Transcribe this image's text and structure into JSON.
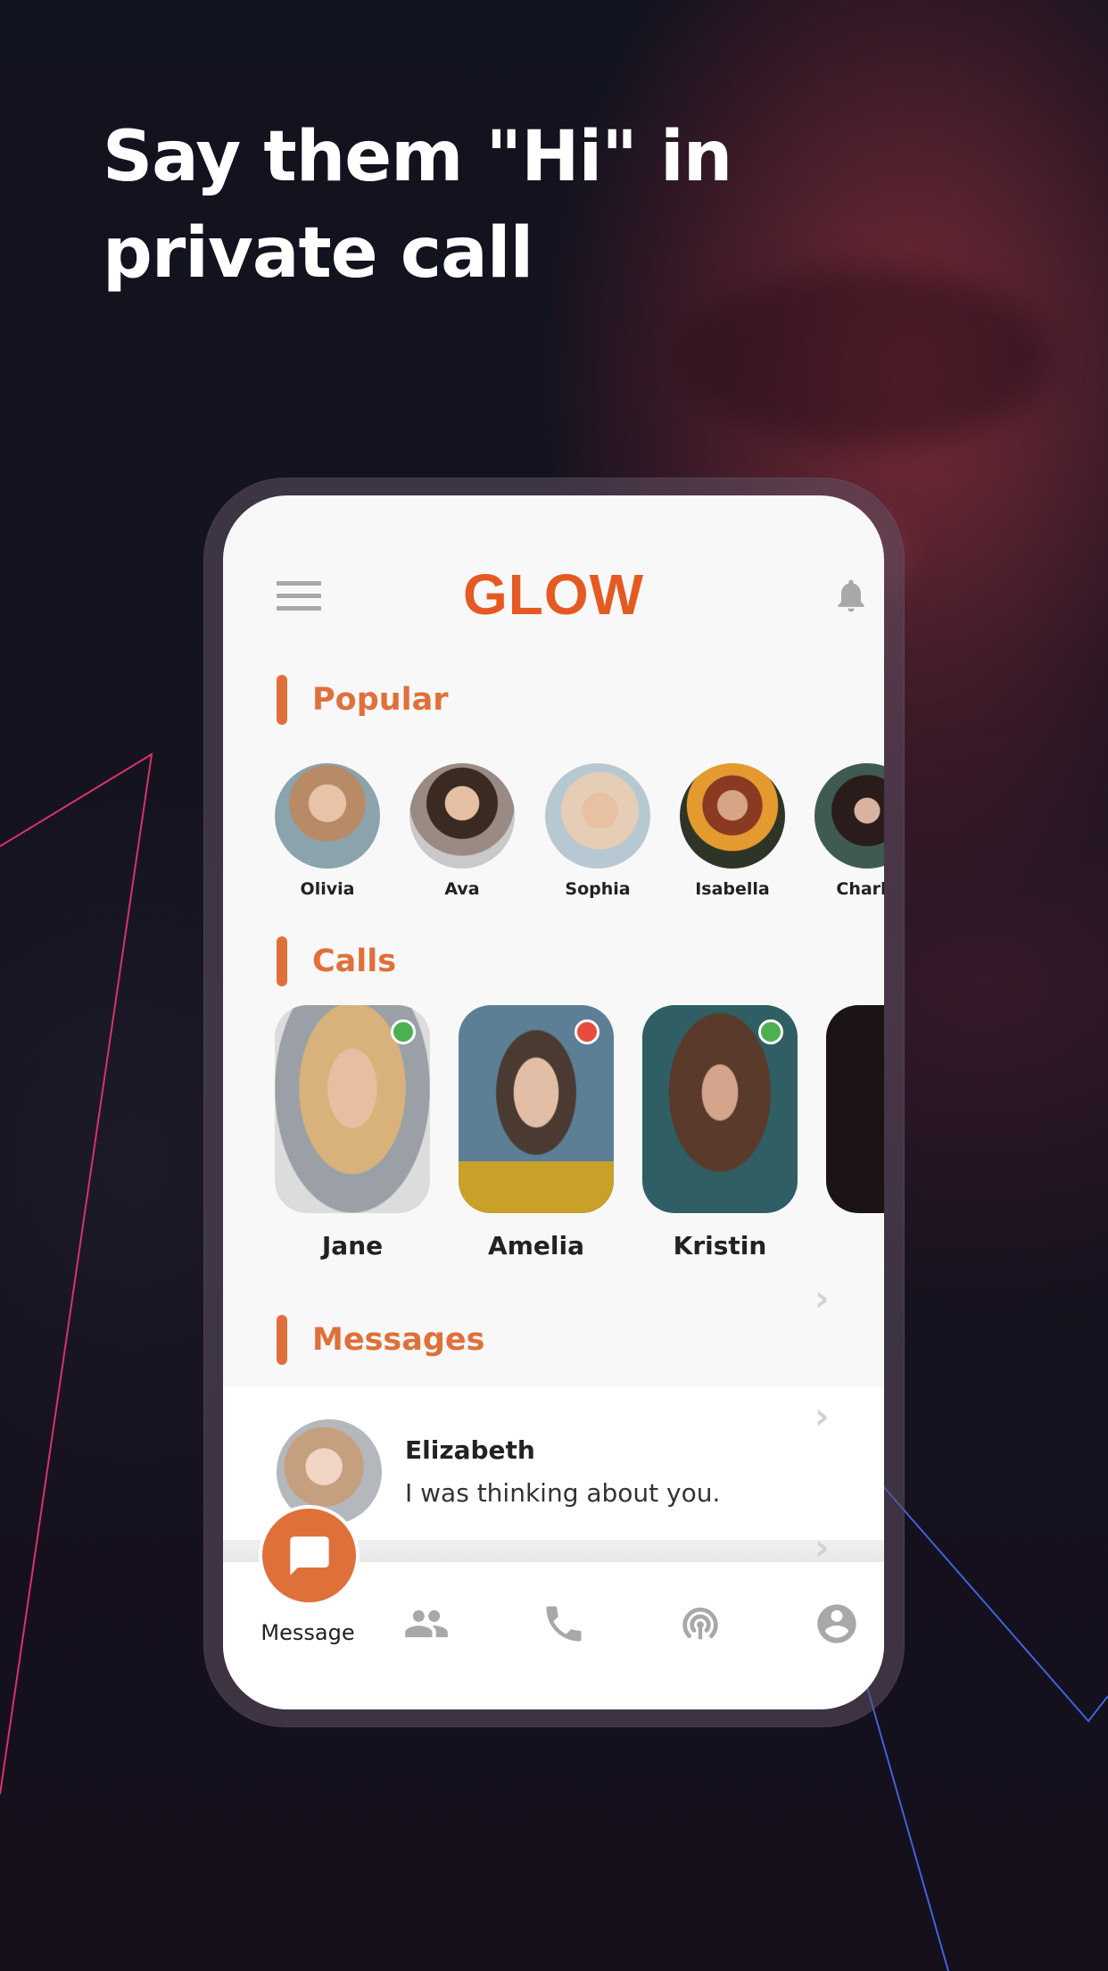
{
  "headline": {
    "line1": "Say them \"Hi\" in",
    "line2": "private call"
  },
  "colors": {
    "accent": "#e0703a",
    "logo": "#e55a22",
    "online": "#4caf50",
    "busy": "#e74c3c",
    "icon_gray": "#a8a8a8"
  },
  "app": {
    "logo": "GLOW",
    "header_icons": {
      "left": "menu-icon",
      "right": "bell-icon"
    },
    "sections": {
      "popular": "Popular",
      "calls": "Calls",
      "messages": "Messages"
    },
    "popular": [
      {
        "name": "Olivia"
      },
      {
        "name": "Ava"
      },
      {
        "name": "Sophia"
      },
      {
        "name": "Isabella"
      },
      {
        "name": "Charlo"
      }
    ],
    "calls": [
      {
        "name": "Jane",
        "status": "online"
      },
      {
        "name": "Amelia",
        "status": "busy"
      },
      {
        "name": "Kristin",
        "status": "online"
      }
    ],
    "messages": [
      {
        "name": "Elizabeth",
        "text": "I was thinking about you."
      }
    ],
    "bottom_nav": {
      "fab_label": "Message",
      "fab_icon": "chat-bubble-icon",
      "items": [
        "people-icon",
        "phone-icon",
        "broadcast-icon",
        "account-icon"
      ]
    }
  }
}
